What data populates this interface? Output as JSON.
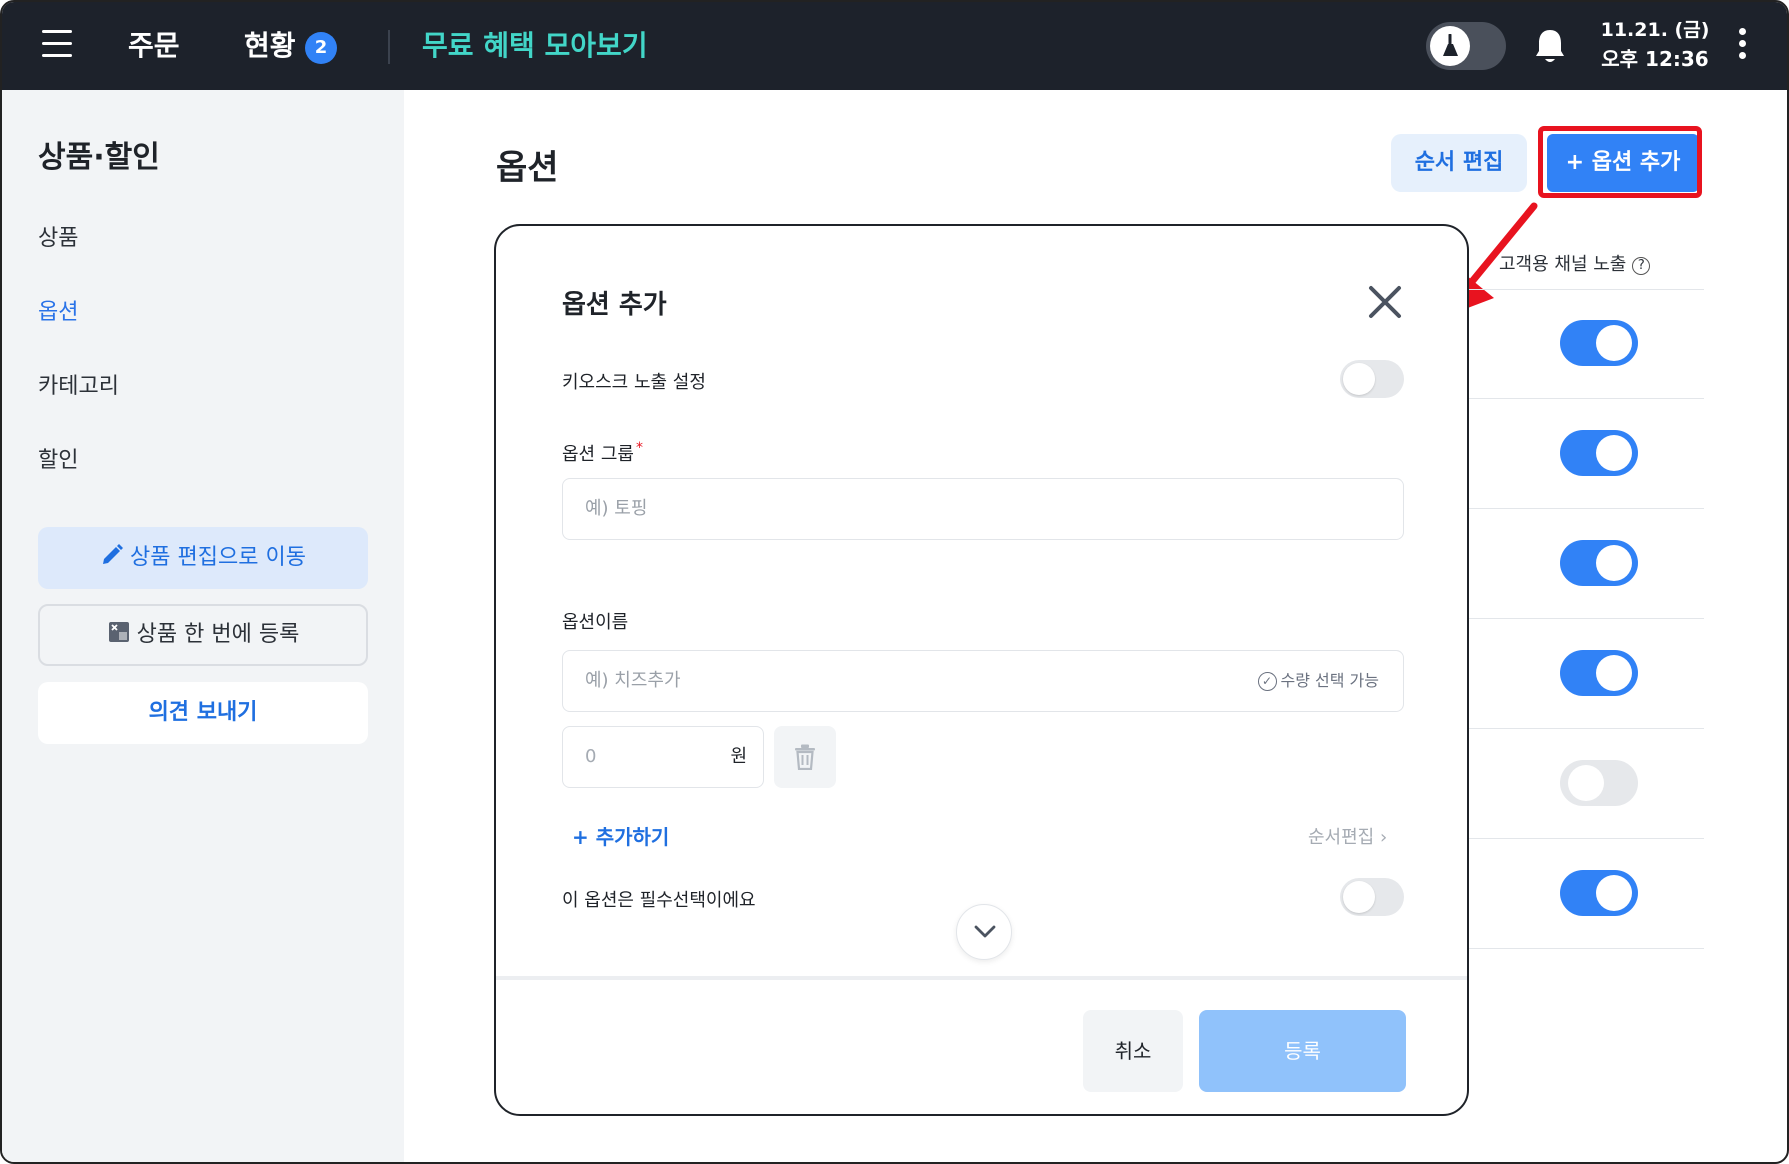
{
  "topbar": {
    "nav_order": "주문",
    "nav_status": "현황",
    "nav_status_badge": "2",
    "nav_benefit": "무료 혜택 모아보기",
    "date": "11.21. (금)",
    "time": "오후 12:36"
  },
  "sidebar": {
    "title": "상품·할인",
    "items": [
      {
        "label": "상품",
        "active": false
      },
      {
        "label": "옵션",
        "active": true
      },
      {
        "label": "카테고리",
        "active": false
      },
      {
        "label": "할인",
        "active": false
      }
    ],
    "btn_edit": "상품 편집으로 이동",
    "btn_bulk": "상품 한 번에 등록",
    "btn_feedback": "의견 보내기"
  },
  "main": {
    "title": "옵션",
    "btn_order_edit": "순서 편집",
    "btn_add_option": "+ 옵션 추가",
    "column_header": "고객용 채널 노출",
    "help_icon": "?",
    "channel_toggles": [
      true,
      true,
      true,
      true,
      false,
      true
    ]
  },
  "modal": {
    "title": "옵션 추가",
    "kiosk_label": "키오스크 노출 설정",
    "kiosk_enabled": false,
    "group_label": "옵션 그룹",
    "required_mark": "*",
    "group_placeholder": "예) 토핑",
    "name_label": "옵션이름",
    "name_placeholder": "예) 치즈추가",
    "qty_selectable": "수량 선택 가능",
    "qty_check_icon": "✓",
    "price_value": "0",
    "price_unit": "원",
    "add_more": "+ 추가하기",
    "order_edit_link": "순서편집 ›",
    "required_option_label": "이 옵션은 필수선택이에요",
    "required_option_enabled": false,
    "btn_cancel": "취소",
    "btn_submit": "등록"
  },
  "colors": {
    "topbar_bg": "#1d222b",
    "accent_blue": "#3182f6",
    "benefit_teal": "#42d6c8",
    "highlight_red": "#e8131f",
    "submit_disabled": "#90c2fb"
  }
}
